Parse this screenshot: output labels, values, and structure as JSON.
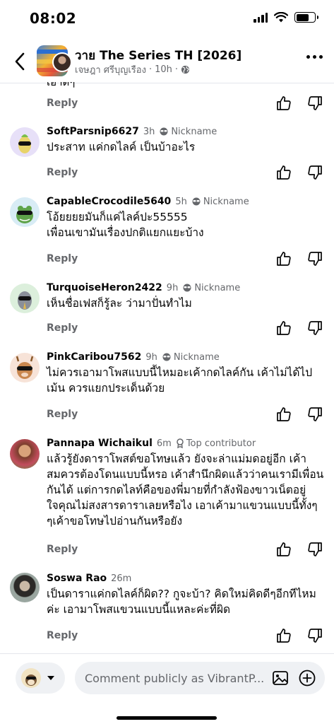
{
  "status_bar": {
    "time": "08:02"
  },
  "header": {
    "group_name": "วาย The Series TH [2026]",
    "author": "เจษฎา ศรีบุญเรือง",
    "age": "10h",
    "separator": "·"
  },
  "actions": {
    "reply_label": "Reply"
  },
  "comments": [
    {
      "name": "SoftParsnip6627",
      "time": "3h",
      "badge": "Nickname",
      "lines": [
        "ประสาท แค่กดไลค์ เป็นบ้าอะไร"
      ]
    },
    {
      "name": "CapableCrocodile5640",
      "time": "5h",
      "badge": "Nickname",
      "lines": [
        "โอ้ยยยยมันก็แค่ไลค์ปะ55555",
        "เพื่อนเขามันเรื่องปกติแยกแยะบ้าง"
      ]
    },
    {
      "name": "TurquoiseHeron2422",
      "time": "9h",
      "badge": "Nickname",
      "lines": [
        "เห็นชื่อเฟสก็รู้ละ ว่ามาปั่นทำไม"
      ]
    },
    {
      "name": "PinkCaribou7562",
      "time": "9h",
      "badge": "Nickname",
      "lines": [
        "ไม่ควรเอามาโพสแบบนี้ไหมอะเค้ากดไลค์กัน เค้าไม่ได้ไป",
        "เม้น ควรแยกประเด็นด้วย"
      ]
    },
    {
      "name": "Pannapa Wichaikul",
      "time": "6m",
      "badge": "Top contributor",
      "lines": [
        "แล้วรู้ยังดาราโพสต์ขอโทษแล้ว ยังจะล่าแม่มดอยู่อีก เค้า",
        "สมควรต้องโดนแบบนี้หรอ เค้าสำนึกผิดแล้วว่าคนเรามีเพื่อน",
        "กันได้ แต่การกดไลท์คือของพี่มายที่กำลังฟ้องขาวเน็ตอยู่",
        "ใจคุณไม่สงสารดาราเลยหรือไง เอาเค้ามาแขวนแบบนี้ทั้งๆ",
        "ๆเค้าขอโทษไปอ่านกันหรือยัง"
      ]
    },
    {
      "name": "Soswa Rao",
      "time": "26m",
      "badge": "",
      "lines": [
        "เป็นดาราแค่กดไลค์ก็ผิด?? กูจะบ้า? คิดใหม่คิดดีๆอีกทีไหม",
        "ค่ะ เอามาโพสแขวนแบบนี้แหละค่ะที่ผิด"
      ]
    }
  ],
  "composer": {
    "placeholder": "Comment publicly as VibrantP..."
  },
  "icons": {
    "back": "chevron-left-icon",
    "more": "more-horizontal-icon",
    "like": "thumbs-up-icon",
    "dislike": "thumbs-down-icon",
    "nickname": "sunglasses-icon",
    "top_contributor": "medal-icon",
    "globe": "globe-icon",
    "photo": "photo-icon",
    "add": "plus-circle-icon"
  }
}
